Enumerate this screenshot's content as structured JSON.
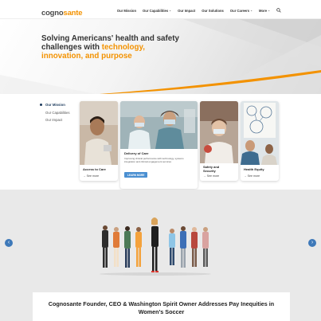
{
  "header": {
    "logo_text_a": "cogno",
    "logo_text_b": "sante",
    "logo_tagline": "INNOVATION · ACCESS · QUALITY",
    "nav": [
      {
        "label": "Our Mission",
        "has_caret": false
      },
      {
        "label": "Our Capabilities",
        "has_caret": true
      },
      {
        "label": "Our Impact",
        "has_caret": false
      },
      {
        "label": "Our Solutions",
        "has_caret": false
      },
      {
        "label": "Our Careers",
        "has_caret": true
      },
      {
        "label": "More",
        "has_caret": true
      }
    ],
    "caret_glyph": "⌄"
  },
  "hero": {
    "title_line1": "Solving Americans' health and safety",
    "title_line2a": "challenges with ",
    "title_line2b": "technology,",
    "title_line3": "innovation, and purpose",
    "accent_color": "#f39200"
  },
  "mission": {
    "subnav": [
      "Our Mission",
      "Our Capabilities",
      "Our Impact"
    ],
    "cards": {
      "access": {
        "title": "Access to Care",
        "more": "→ See more"
      },
      "delivery": {
        "title": "Delivery of Care",
        "desc": "Improving clinical performance with technology, systems integration and clinical engagement services",
        "button": "LEARN MORE"
      },
      "safety": {
        "title_line1": "Safety and",
        "title_line2": "Security",
        "more": "→ See more"
      },
      "equity": {
        "title": "Health Equity",
        "more": "→ See more"
      }
    }
  },
  "carousel": {
    "prev": "‹",
    "next": "›",
    "headline": "Cognosante Founder, CEO & Washington Spirit Owner Addresses Pay Inequities in Women's Soccer",
    "arrow_color": "#3e79b9"
  }
}
